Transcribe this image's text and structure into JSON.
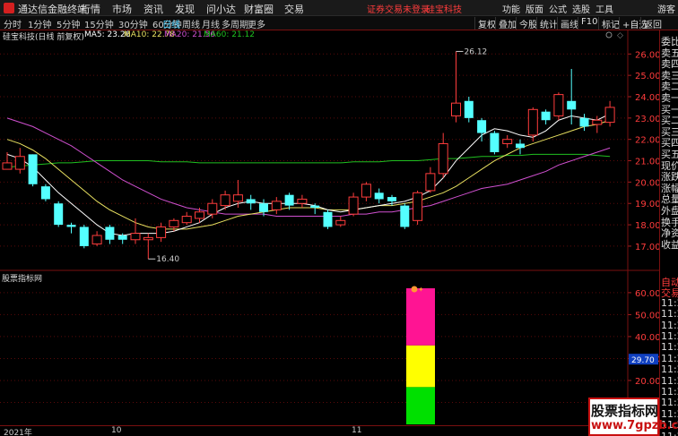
{
  "titlebar": {
    "app_name": "通达信金融终端",
    "menus": [
      "行情",
      "市场",
      "资讯",
      "发现",
      "问小达",
      "财富圈",
      "交易"
    ],
    "warning": "证券交易未登录",
    "stock_title": "硅宝科技",
    "right_menus": [
      "功能",
      "版面",
      "公式",
      "选股",
      "工具"
    ],
    "guest": "游客"
  },
  "toolbar": {
    "periods": [
      "分时",
      "1分钟",
      "5分钟",
      "15分钟",
      "30分钟",
      "60分钟",
      "日线",
      "周线",
      "月线",
      "多周期",
      "更多"
    ],
    "active_period": "日线",
    "buttons": [
      "复权",
      "叠加",
      "今股",
      "统计",
      "画线",
      "F10",
      "标记",
      "+自选",
      "返回"
    ]
  },
  "info": {
    "stock": "硅宝科技(日线 前复权)",
    "ma5": "MA5: 23.26",
    "ma10": "MA10: 22.78",
    "ma20": "MA20: 21.56",
    "ma60": "MA60: 21.12",
    "colors": {
      "ma5": "#ffffff",
      "ma10": "#e8e060",
      "ma20": "#d050d0",
      "ma60": "#20c020"
    }
  },
  "price_axis": [
    "26.00",
    "25.00",
    "24.00",
    "23.00",
    "22.00",
    "21.00",
    "20.00",
    "19.00",
    "18.00",
    "17.00"
  ],
  "annotations": {
    "high": "26.12",
    "low": "16.40"
  },
  "sub_chart": {
    "label": "股票指标网",
    "axis": [
      "60.00",
      "50.00",
      "40.00",
      "30.00",
      "20.00",
      "10.00"
    ],
    "marker_value": "29.70",
    "bar_segments": [
      {
        "from": 0,
        "to": 17,
        "color": "#00e000"
      },
      {
        "from": 17,
        "to": 36,
        "color": "#ffff00"
      },
      {
        "from": 36,
        "to": 62,
        "color": "#ff1493"
      }
    ]
  },
  "right_panel": {
    "top": [
      "委比",
      "卖五",
      "卖四",
      "卖三",
      "卖二",
      "卖一",
      "买一",
      "买二",
      "买三",
      "买四",
      "买五",
      "现价",
      "涨跌",
      "涨幅",
      "总量",
      "外盘",
      "换手",
      "净资",
      "收益"
    ],
    "bottom": [
      "自动",
      "交易",
      "11:27",
      "11:27",
      "11:28",
      "11:28",
      "11:29",
      "11:29",
      "11:29",
      "11:29",
      "11:29",
      "11:29",
      "11:29",
      "11:29",
      "11:29",
      "11:29"
    ]
  },
  "date_axis": [
    "2021年",
    "10",
    "11"
  ],
  "watermark": {
    "text": "股票指标网",
    "url": "www.7gpzb.com"
  },
  "chart_data": {
    "type": "candlestick",
    "ylim": [
      16.2,
      26.6
    ],
    "candles": [
      {
        "o": 20.6,
        "c": 20.9,
        "h": 21.4,
        "l": 20.6
      },
      {
        "o": 20.6,
        "c": 21.2,
        "h": 21.6,
        "l": 20.4
      },
      {
        "o": 21.3,
        "c": 19.9,
        "h": 21.3,
        "l": 19.8
      },
      {
        "o": 19.8,
        "c": 19.2,
        "h": 19.9,
        "l": 19.1
      },
      {
        "o": 19.0,
        "c": 18.0,
        "h": 19.1,
        "l": 17.9
      },
      {
        "o": 18.0,
        "c": 17.9,
        "h": 18.1,
        "l": 17.6
      },
      {
        "o": 17.9,
        "c": 17.0,
        "h": 18.0,
        "l": 16.9
      },
      {
        "o": 17.1,
        "c": 17.5,
        "h": 17.7,
        "l": 17.0
      },
      {
        "o": 17.9,
        "c": 17.3,
        "h": 18.0,
        "l": 17.1
      },
      {
        "o": 17.5,
        "c": 17.3,
        "h": 17.6,
        "l": 17.1
      },
      {
        "o": 17.3,
        "c": 17.6,
        "h": 18.3,
        "l": 17.1
      },
      {
        "o": 17.3,
        "c": 17.4,
        "h": 17.6,
        "l": 16.4
      },
      {
        "o": 17.4,
        "c": 17.9,
        "h": 18.1,
        "l": 17.2
      },
      {
        "o": 17.9,
        "c": 18.2,
        "h": 18.3,
        "l": 17.7
      },
      {
        "o": 18.1,
        "c": 18.4,
        "h": 18.6,
        "l": 18.0
      },
      {
        "o": 18.3,
        "c": 18.6,
        "h": 18.8,
        "l": 18.1
      },
      {
        "o": 18.5,
        "c": 19.0,
        "h": 19.2,
        "l": 18.3
      },
      {
        "o": 18.9,
        "c": 19.4,
        "h": 19.6,
        "l": 18.7
      },
      {
        "o": 19.1,
        "c": 19.4,
        "h": 20.1,
        "l": 18.8
      },
      {
        "o": 19.2,
        "c": 19.0,
        "h": 19.4,
        "l": 18.7
      },
      {
        "o": 19.0,
        "c": 18.6,
        "h": 19.2,
        "l": 18.4
      },
      {
        "o": 18.7,
        "c": 19.1,
        "h": 19.3,
        "l": 18.5
      },
      {
        "o": 19.4,
        "c": 18.9,
        "h": 19.5,
        "l": 18.7
      },
      {
        "o": 19.0,
        "c": 19.2,
        "h": 19.4,
        "l": 18.8
      },
      {
        "o": 18.9,
        "c": 18.8,
        "h": 19.0,
        "l": 18.5
      },
      {
        "o": 18.6,
        "c": 17.9,
        "h": 18.7,
        "l": 17.8
      },
      {
        "o": 18.0,
        "c": 18.2,
        "h": 18.4,
        "l": 17.9
      },
      {
        "o": 18.5,
        "c": 19.3,
        "h": 19.5,
        "l": 18.4
      },
      {
        "o": 19.3,
        "c": 19.9,
        "h": 20.0,
        "l": 19.1
      },
      {
        "o": 19.5,
        "c": 19.2,
        "h": 19.7,
        "l": 19.0
      },
      {
        "o": 19.3,
        "c": 19.1,
        "h": 19.4,
        "l": 18.9
      },
      {
        "o": 18.9,
        "c": 17.9,
        "h": 19.0,
        "l": 17.8
      },
      {
        "o": 18.2,
        "c": 19.5,
        "h": 19.6,
        "l": 18.0
      },
      {
        "o": 19.6,
        "c": 20.4,
        "h": 20.7,
        "l": 19.5
      },
      {
        "o": 20.4,
        "c": 21.8,
        "h": 22.3,
        "l": 20.2
      },
      {
        "o": 23.1,
        "c": 23.7,
        "h": 26.12,
        "l": 22.8
      },
      {
        "o": 23.8,
        "c": 23.0,
        "h": 24.0,
        "l": 22.8
      },
      {
        "o": 22.9,
        "c": 22.3,
        "h": 23.0,
        "l": 21.9
      },
      {
        "o": 22.3,
        "c": 21.4,
        "h": 22.4,
        "l": 21.3
      },
      {
        "o": 21.8,
        "c": 22.0,
        "h": 22.2,
        "l": 21.6
      },
      {
        "o": 21.8,
        "c": 21.6,
        "h": 22.0,
        "l": 21.3
      },
      {
        "o": 22.2,
        "c": 23.4,
        "h": 23.5,
        "l": 21.9
      },
      {
        "o": 23.3,
        "c": 22.9,
        "h": 23.4,
        "l": 22.7
      },
      {
        "o": 23.1,
        "c": 24.1,
        "h": 24.2,
        "l": 22.9
      },
      {
        "o": 23.8,
        "c": 23.4,
        "h": 25.3,
        "l": 22.7
      },
      {
        "o": 23.0,
        "c": 22.6,
        "h": 23.2,
        "l": 22.4
      },
      {
        "o": 22.7,
        "c": 22.9,
        "h": 23.1,
        "l": 22.3
      },
      {
        "o": 22.8,
        "c": 23.5,
        "h": 23.8,
        "l": 22.6
      }
    ],
    "ma5": [
      21.3,
      21.1,
      20.7,
      20.1,
      19.5,
      19.0,
      18.5,
      18.0,
      17.6,
      17.5,
      17.6,
      17.6,
      17.6,
      17.7,
      17.9,
      18.1,
      18.5,
      18.8,
      19.0,
      19.1,
      19.0,
      19.0,
      19.0,
      19.0,
      18.9,
      18.7,
      18.6,
      18.7,
      18.8,
      18.9,
      19.0,
      19.1,
      19.3,
      19.6,
      20.2,
      21.0,
      21.6,
      22.2,
      22.5,
      22.4,
      22.2,
      22.1,
      22.4,
      22.9,
      23.1,
      23.0,
      22.9,
      23.2
    ],
    "ma10": [
      22.0,
      21.8,
      21.5,
      21.1,
      20.6,
      20.1,
      19.6,
      19.1,
      18.7,
      18.4,
      18.1,
      17.9,
      17.8,
      17.8,
      17.8,
      17.9,
      18.0,
      18.2,
      18.4,
      18.5,
      18.6,
      18.7,
      18.8,
      18.8,
      18.8,
      18.7,
      18.7,
      18.7,
      18.8,
      18.9,
      18.9,
      19.0,
      19.1,
      19.3,
      19.5,
      19.8,
      20.2,
      20.6,
      21.0,
      21.3,
      21.6,
      21.8,
      22.0,
      22.2,
      22.4,
      22.6,
      22.7,
      22.9
    ],
    "ma20": [
      23.0,
      22.8,
      22.6,
      22.3,
      22.0,
      21.7,
      21.3,
      20.9,
      20.5,
      20.1,
      19.8,
      19.5,
      19.2,
      19.0,
      18.8,
      18.7,
      18.6,
      18.5,
      18.5,
      18.5,
      18.5,
      18.4,
      18.4,
      18.4,
      18.4,
      18.4,
      18.4,
      18.5,
      18.5,
      18.6,
      18.6,
      18.7,
      18.8,
      18.9,
      19.1,
      19.3,
      19.5,
      19.7,
      19.8,
      19.9,
      20.1,
      20.3,
      20.5,
      20.8,
      21.0,
      21.2,
      21.4,
      21.6
    ],
    "ma60": [
      20.7,
      20.75,
      20.8,
      20.85,
      20.9,
      20.9,
      20.95,
      21.0,
      21.0,
      21.0,
      21.0,
      21.0,
      20.95,
      20.95,
      20.95,
      20.9,
      20.9,
      20.9,
      20.9,
      20.9,
      20.9,
      20.9,
      20.9,
      20.9,
      20.9,
      20.9,
      20.9,
      20.95,
      20.95,
      20.95,
      21.0,
      21.0,
      21.0,
      21.05,
      21.1,
      21.1,
      21.15,
      21.2,
      21.2,
      21.25,
      21.25,
      21.3,
      21.3,
      21.3,
      21.3,
      21.3,
      21.25,
      21.2
    ]
  }
}
